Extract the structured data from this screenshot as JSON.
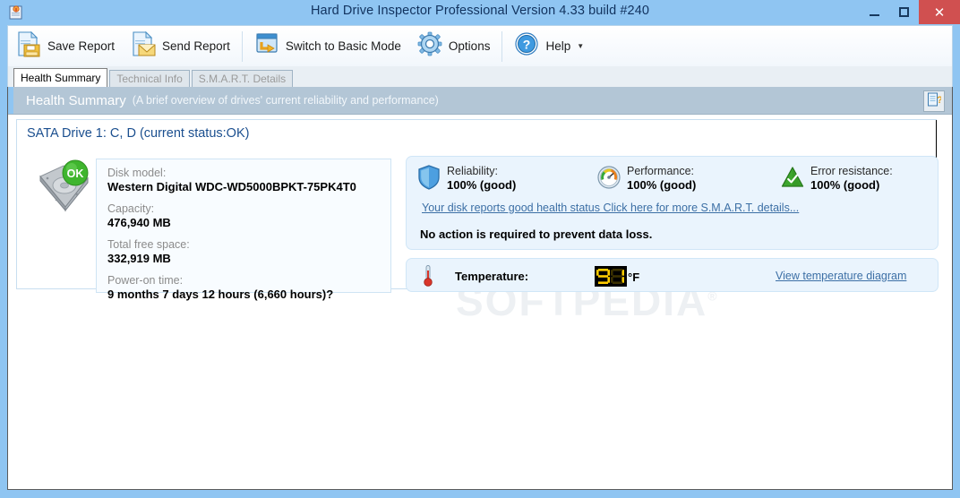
{
  "window": {
    "title": "Hard Drive Inspector Professional Version 4.33 build #240",
    "app_icon": "clipboard-icon",
    "minimize_label": "",
    "maximize_label": "",
    "close_label": "✕",
    "titlebar_color": "#8fc5f2",
    "close_button_color": "#d05050"
  },
  "toolbar": {
    "items": [
      {
        "label": "Save Report",
        "icon": "save-report-icon"
      },
      {
        "label": "Send Report",
        "icon": "send-report-icon"
      },
      {
        "label": "Switch to Basic Mode",
        "icon": "switch-mode-icon"
      },
      {
        "label": "Options",
        "icon": "gear-icon"
      },
      {
        "label": "Help",
        "icon": "help-icon",
        "caret": "▼"
      }
    ]
  },
  "tabs": [
    {
      "label": "Health Summary",
      "active": true
    },
    {
      "label": "Technical Info",
      "active": false
    },
    {
      "label": "S.M.A.R.T. Details",
      "active": false
    }
  ],
  "section": {
    "title": "Health Summary",
    "subtitle": "(A brief overview of drives' current reliability and performance)",
    "help_icon": "document-question-icon"
  },
  "drive": {
    "title": "SATA Drive 1: C, D (current status:OK)",
    "status_badge": "OK",
    "icon": "hard-drive-icon",
    "fields": [
      {
        "label": "Disk model:",
        "value": "Western Digital WDC-WD5000BPKT-75PK4T0"
      },
      {
        "label": "Capacity:",
        "value": "476,940 MB"
      },
      {
        "label": "Total free space:",
        "value": "332,919 MB"
      },
      {
        "label": "Power-on time:",
        "value": "9 months 7 days 12 hours (6,660 hours)?"
      }
    ]
  },
  "metrics": [
    {
      "label": "Reliability:",
      "value": "100% (good)",
      "icon": "shield-icon"
    },
    {
      "label": "Performance:",
      "value": "100% (good)",
      "icon": "gauge-icon"
    },
    {
      "label": "Error resistance:",
      "value": "100% (good)",
      "icon": "triangle-check-icon"
    }
  ],
  "smart_link": "Your disk reports good health status Click here for more S.M.A.R.T. details...",
  "no_action_text": "No action is required to prevent data loss.",
  "temperature": {
    "label": "Temperature:",
    "value": "91",
    "unit": "°F",
    "link": "View temperature diagram",
    "icon": "thermometer-icon",
    "lcd_color": "#ffcc00",
    "lcd_background": "#000000"
  },
  "watermark": {
    "text": "SOFTPEDIA",
    "mark": "®"
  }
}
